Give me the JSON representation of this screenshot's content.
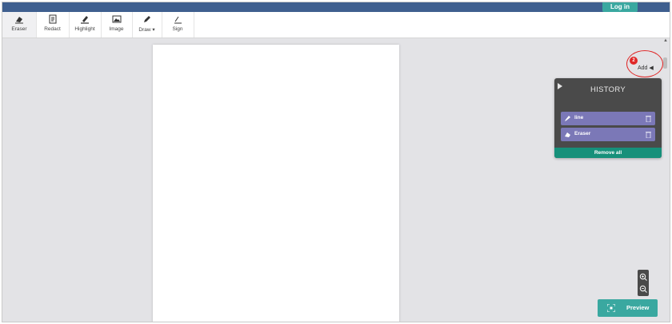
{
  "header": {
    "login_label": "Log in"
  },
  "toolbar": {
    "tools": [
      {
        "label": "Eraser",
        "icon": "eraser-icon"
      },
      {
        "label": "Redact",
        "icon": "redact-icon"
      },
      {
        "label": "Highlight",
        "icon": "highlight-icon"
      },
      {
        "label": "Image",
        "icon": "image-icon"
      },
      {
        "label": "Draw",
        "icon": "pen-icon"
      },
      {
        "label": "Sign",
        "icon": "sign-icon"
      }
    ],
    "active": "Eraser"
  },
  "add_page": {
    "label": "Add",
    "badge": "2"
  },
  "history": {
    "title": "HISTORY",
    "items": [
      {
        "label": "line",
        "icon": "pen-icon"
      },
      {
        "label": "Eraser",
        "icon": "eraser-icon"
      }
    ],
    "remove_all_label": "Remove all"
  },
  "preview": {
    "label": "Preview"
  },
  "colors": {
    "topbar": "#3f5f8f",
    "accent": "#3aa8a0",
    "history_bg": "#4a4a4a",
    "history_item": "#7b78b7",
    "remove_all": "#16907a",
    "badge": "#e02828"
  }
}
